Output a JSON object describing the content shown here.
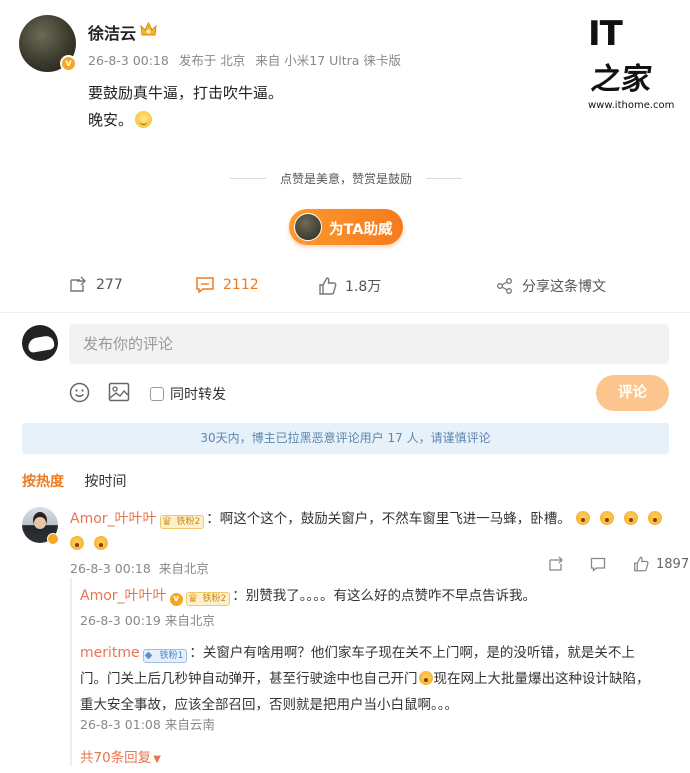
{
  "watermark": {
    "brand": "IT",
    "brand_cn": "之家",
    "url": "www.ithome.com"
  },
  "post": {
    "author": "徐洁云",
    "meta": [
      "26-8-3 00:18",
      "发布于 北京",
      "来自 小米17 Ultra 徕卡版"
    ],
    "line1": "要鼓励真牛逼，打击吹牛逼。",
    "line2": "晚安。"
  },
  "reward": {
    "slogan": "点赞是美意，赞赏是鼓励",
    "button": "为TA助威"
  },
  "actions": {
    "repost": "277",
    "comments": "2112",
    "likes": "1.8万",
    "share": "分享这条博文"
  },
  "composer": {
    "placeholder": "发布你的评论",
    "repost_label": "同时转发",
    "submit": "评论"
  },
  "notice": "30天内，博主已拉黑恶意评论用户 17 人，请谨慎评论",
  "sort": {
    "hot": "按热度",
    "time": "按时间"
  },
  "comment": {
    "user": "Amor_叶叶叶",
    "fans_badge": "铁粉2",
    "text": "：啊这个这个，鼓励关窗户，不然车窗里飞进一马蜂，卧槽。",
    "time": "26-8-3 00:18",
    "location": "来自北京",
    "likes": "1897"
  },
  "replies": [
    {
      "user": "Amor_叶叶叶",
      "fans_badge": "铁粉2",
      "text": "：别赞我了。。。。有这么好的点赞咋不早点告诉我。",
      "time": "26-8-3 00:19",
      "location": "来自北京"
    },
    {
      "user": "meritme",
      "fans_badge": "铁粉1",
      "text_a": "：关窗户有啥用啊？他们家车子现在关不上门啊，是的没听错，就是关不上门。门关上后几秒钟自动弹开，甚至行驶途中也自己开门",
      "text_b": "现在网上大批量爆出这种设计缺陷，重大安全事故，应该全部召回，否则就是把用户当小白鼠啊。。。",
      "time": "26-8-3 01:08",
      "location": "来自云南"
    }
  ],
  "more_replies": "共70条回复"
}
